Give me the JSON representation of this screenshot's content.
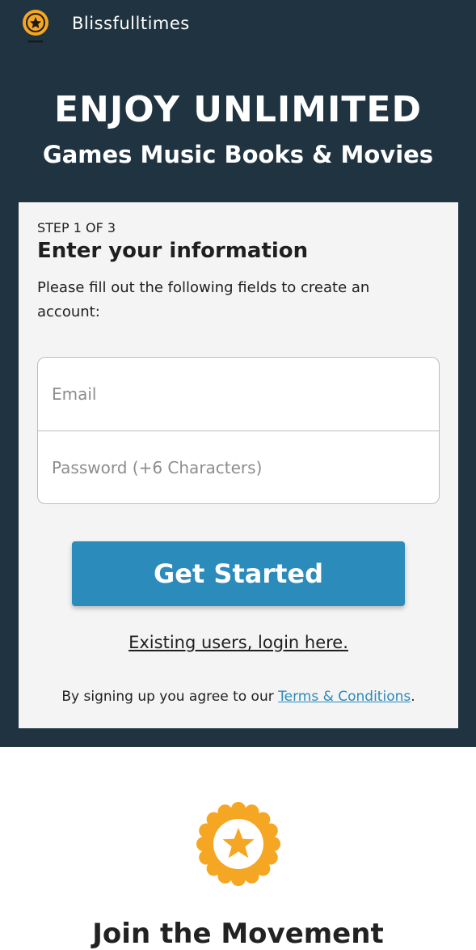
{
  "brand": {
    "name": "Blissfulltimes",
    "logo_icon": "star-medal-icon"
  },
  "hero": {
    "title": "ENJOY UNLIMITED",
    "subtitle": "Games Music Books & Movies"
  },
  "form": {
    "step_label": "STEP 1 OF 3",
    "title": "Enter your information",
    "description": "Please fill out the following fields to create an account:",
    "email_placeholder": "Email",
    "email_value": "",
    "password_placeholder": "Password (+6 Characters)",
    "password_value": "",
    "submit_label": "Get Started",
    "login_link_label": "Existing users, login here.",
    "terms_prefix": "By signing up you agree to our ",
    "terms_link_label": "Terms & Conditions",
    "terms_suffix": "."
  },
  "movement": {
    "badge_icon": "star-badge-icon",
    "title": "Join the Movement"
  },
  "colors": {
    "header_background": "#1f3341",
    "card_background": "#f4f4f4",
    "accent": "#2b8bbb",
    "badge": "#f5a623"
  }
}
